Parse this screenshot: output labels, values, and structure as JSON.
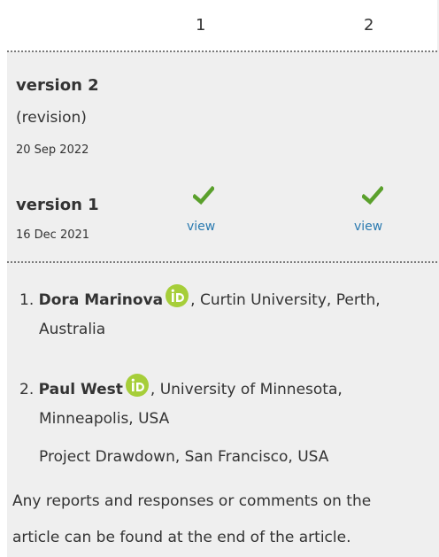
{
  "columns": [
    "1",
    "2"
  ],
  "versions": [
    {
      "title": "version 2",
      "note": "(revision)",
      "date": "20 Sep 2022"
    },
    {
      "title": "version 1",
      "date": "16 Dec 2021",
      "reports": [
        {
          "status_icon": "check-icon",
          "link": "view"
        },
        {
          "status_icon": "check-icon",
          "link": "view"
        }
      ]
    }
  ],
  "reviewers": [
    {
      "number": "1.",
      "name": "Dora Marinova",
      "affiliation_line1": ", Curtin University, Perth,",
      "affiliation_line2": "Australia"
    },
    {
      "number": "2.",
      "name": "Paul West",
      "affiliation_line1": ", University of Minnesota,",
      "affiliation_line2": "Minneapolis, USA",
      "affiliation_line3": "Project Drawdown, San Francisco, USA"
    }
  ],
  "footer": {
    "line1": "Any reports and responses or comments on the",
    "line2": "article can be found at the end of the article."
  },
  "colors": {
    "check": "#5aa02c",
    "link": "#2a7ab0",
    "orcid": "#a6ce39"
  },
  "icons": {
    "orcid": "orcid-icon",
    "check": "check-icon"
  }
}
